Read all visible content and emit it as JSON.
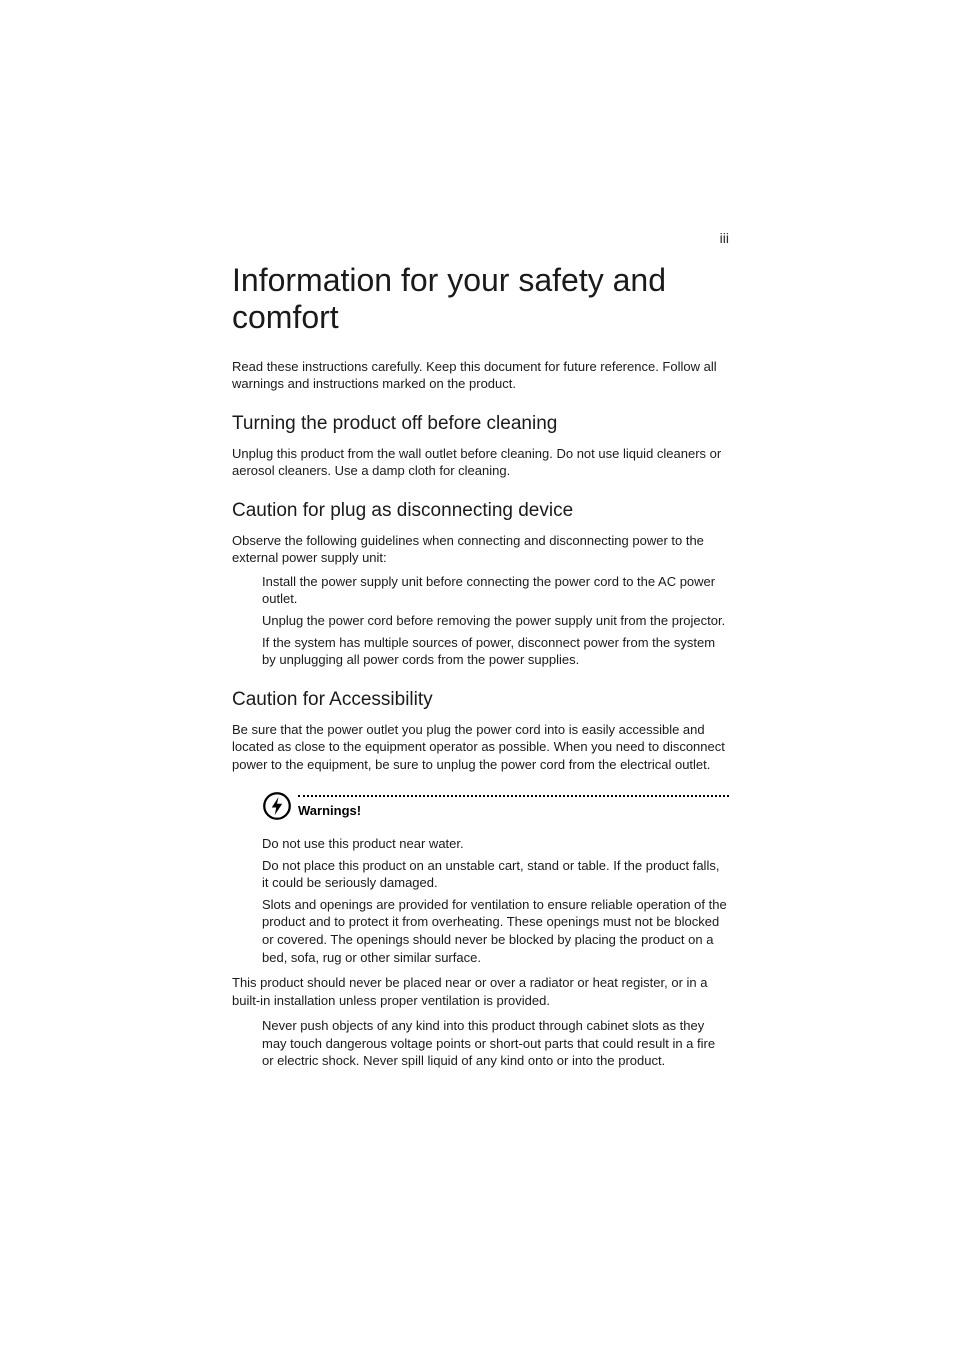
{
  "pageNumber": "iii",
  "title": "Information for your safety and comfort",
  "intro": "Read these instructions carefully. Keep this document for future reference. Follow all warnings and instructions marked on the product.",
  "section1": {
    "heading": "Turning the product off before cleaning",
    "body": "Unplug this product from the wall outlet before cleaning. Do not use liquid cleaners or aerosol cleaners. Use a damp cloth for cleaning."
  },
  "section2": {
    "heading": "Caution for plug as disconnecting device",
    "body": "Observe the following guidelines when connecting and disconnecting power to the external power supply unit:",
    "items": [
      "Install the power supply unit before connecting the power cord to the AC power outlet.",
      "Unplug the power cord before removing the power supply unit from the projector.",
      "If the system has multiple sources of power, disconnect power from the system by unplugging all power cords from the power supplies."
    ]
  },
  "section3": {
    "heading": "Caution for Accessibility",
    "body": "Be sure that the power outlet you plug the power cord into is easily accessible and located as close to the equipment operator as possible. When you need to disconnect power to the equipment, be sure to unplug the power cord from the electrical outlet.",
    "warningLabel": "Warnings!",
    "warningItems": [
      "Do not use this product near water.",
      "Do not place this product on an unstable cart, stand or table. If the product falls, it could be seriously damaged.",
      "Slots and openings are provided for ventilation to ensure reliable operation of the product and to protect it from overheating. These openings must not be blocked or covered. The openings should never be blocked by placing the product on a bed, sofa, rug or other similar surface."
    ],
    "paraAfter": "This product should never be placed near or over a radiator or heat register, or in a built-in installation unless proper ventilation is provided.",
    "itemsAfter": [
      "Never push objects of any kind into this product through cabinet slots as they may touch dangerous voltage points or short-out parts that could result in a fire or electric shock. Never spill liquid of any kind onto or into the product."
    ]
  }
}
